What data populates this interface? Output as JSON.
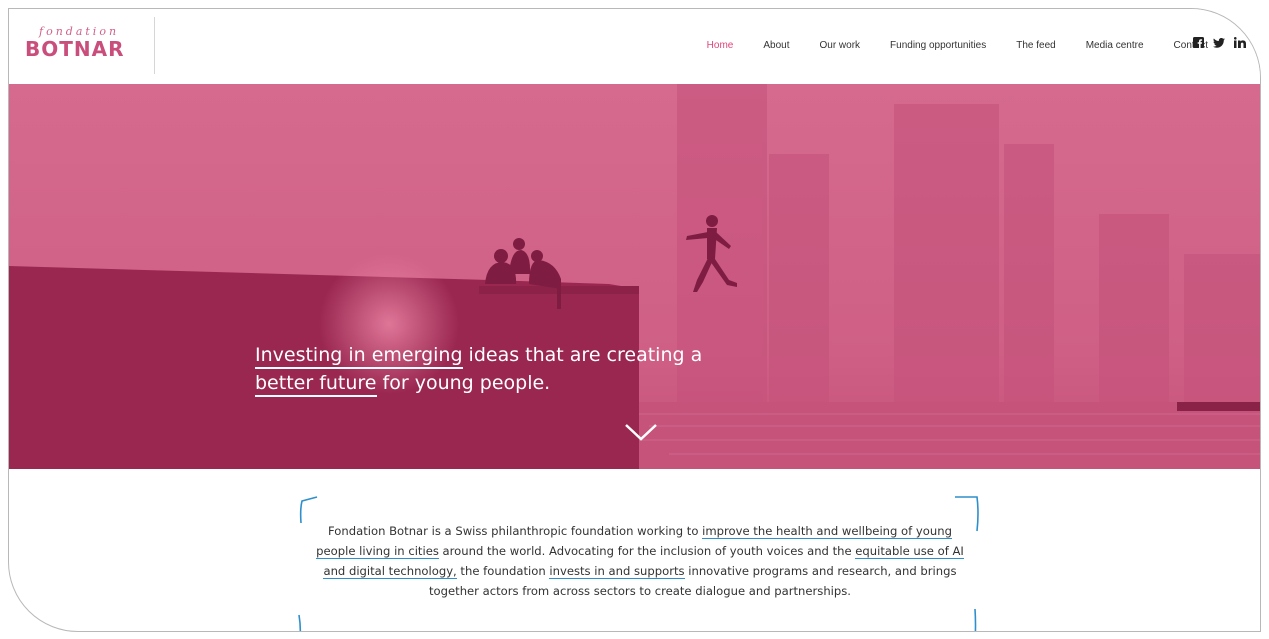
{
  "logo": {
    "top": "fondation",
    "bottom": "BOTNAR"
  },
  "nav": {
    "items": [
      {
        "label": "Home",
        "active": true
      },
      {
        "label": "About"
      },
      {
        "label": "Our work"
      },
      {
        "label": "Funding opportunities"
      },
      {
        "label": "The feed"
      },
      {
        "label": "Media centre"
      },
      {
        "label": "Contact"
      }
    ]
  },
  "social": [
    "facebook-icon",
    "twitter-icon",
    "linkedin-icon"
  ],
  "colors": {
    "accent": "#e0457a",
    "brand": "#c94e7c",
    "hero": "#c9527a",
    "link_underline": "#2e8fcc"
  },
  "hero": {
    "line1_u": "Investing in emerging",
    "line1_rest": " ideas that are creating a",
    "line2_u": "better future",
    "line2_rest": " for young people."
  },
  "intro": {
    "p1": "Fondation Botnar is a Swiss philanthropic foundation working to ",
    "l1": "improve the health and wellbeing of young people living in cities",
    "p2": " around the world. Advocating for the inclusion of youth voices and the ",
    "l2": "equitable use of AI and digital technology,",
    "p3": " the foundation ",
    "l3": "invests in and supports",
    "p4": " innovative programs and research, and brings together actors from across sectors to create dialogue and partnerships."
  }
}
